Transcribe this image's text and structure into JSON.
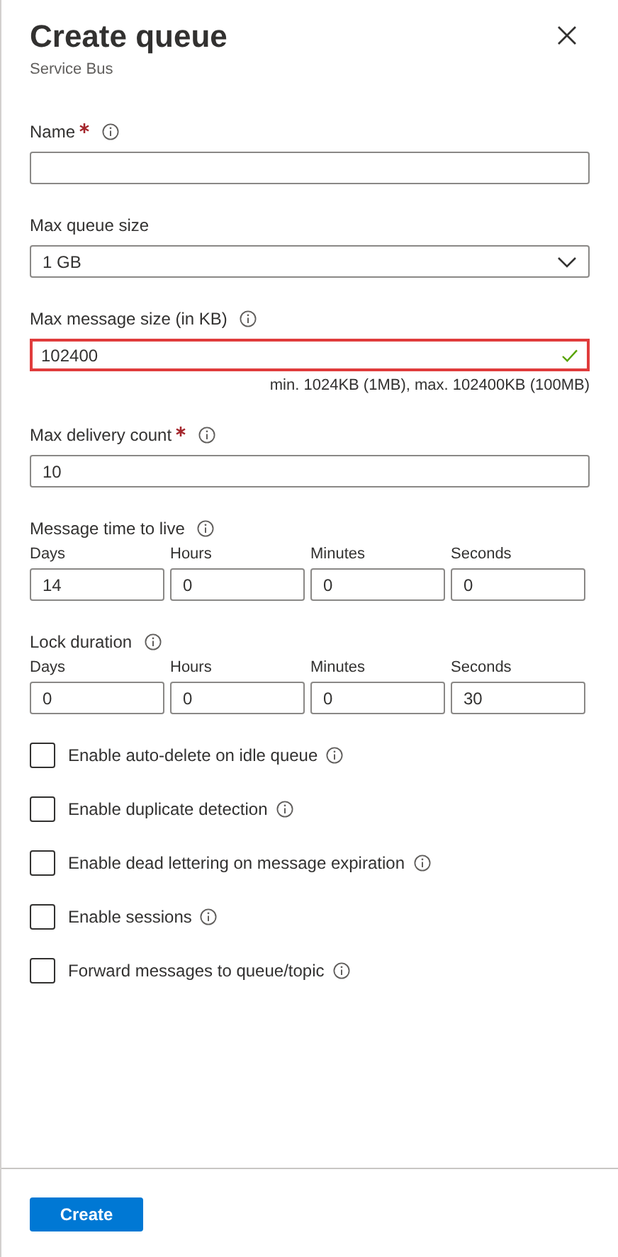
{
  "header": {
    "title": "Create queue",
    "subtitle": "Service Bus"
  },
  "fields": [
    {
      "kind": "text",
      "label": "Name",
      "required": true,
      "info": true,
      "highlighted": false,
      "valid": false
    },
    {
      "kind": "select",
      "label": "Max queue size",
      "required": false,
      "info": false,
      "value": "1 GB"
    },
    {
      "kind": "text",
      "label": "Max message size (in KB)",
      "required": false,
      "info": true,
      "value": "102400",
      "highlighted": true,
      "valid": true,
      "hint": "min. 1024KB (1MB), max. 102400KB (100MB)"
    },
    {
      "kind": "text",
      "label": "Max delivery count",
      "required": true,
      "info": true,
      "value": "10",
      "highlighted": false,
      "valid": false
    },
    {
      "kind": "duration",
      "label": "Message time to live",
      "required": false,
      "info": true,
      "parts": [
        {
          "label": "Days",
          "value": "14"
        },
        {
          "label": "Hours",
          "value": "0"
        },
        {
          "label": "Minutes",
          "value": "0"
        },
        {
          "label": "Seconds",
          "value": "0"
        }
      ]
    },
    {
      "kind": "duration",
      "label": "Lock duration",
      "required": false,
      "info": true,
      "parts": [
        {
          "label": "Days",
          "value": "0"
        },
        {
          "label": "Hours",
          "value": "0"
        },
        {
          "label": "Minutes",
          "value": "0"
        },
        {
          "label": "Seconds",
          "value": "30"
        }
      ]
    }
  ],
  "options": [
    {
      "label": "Enable auto-delete on idle queue",
      "checked": false,
      "info": true
    },
    {
      "label": "Enable duplicate detection",
      "checked": false,
      "info": true
    },
    {
      "label": "Enable dead lettering on message expiration",
      "checked": false,
      "info": true
    },
    {
      "label": "Enable sessions",
      "checked": false,
      "info": true
    },
    {
      "label": "Forward messages to queue/topic",
      "checked": false,
      "info": true
    }
  ],
  "create_button": "Create"
}
